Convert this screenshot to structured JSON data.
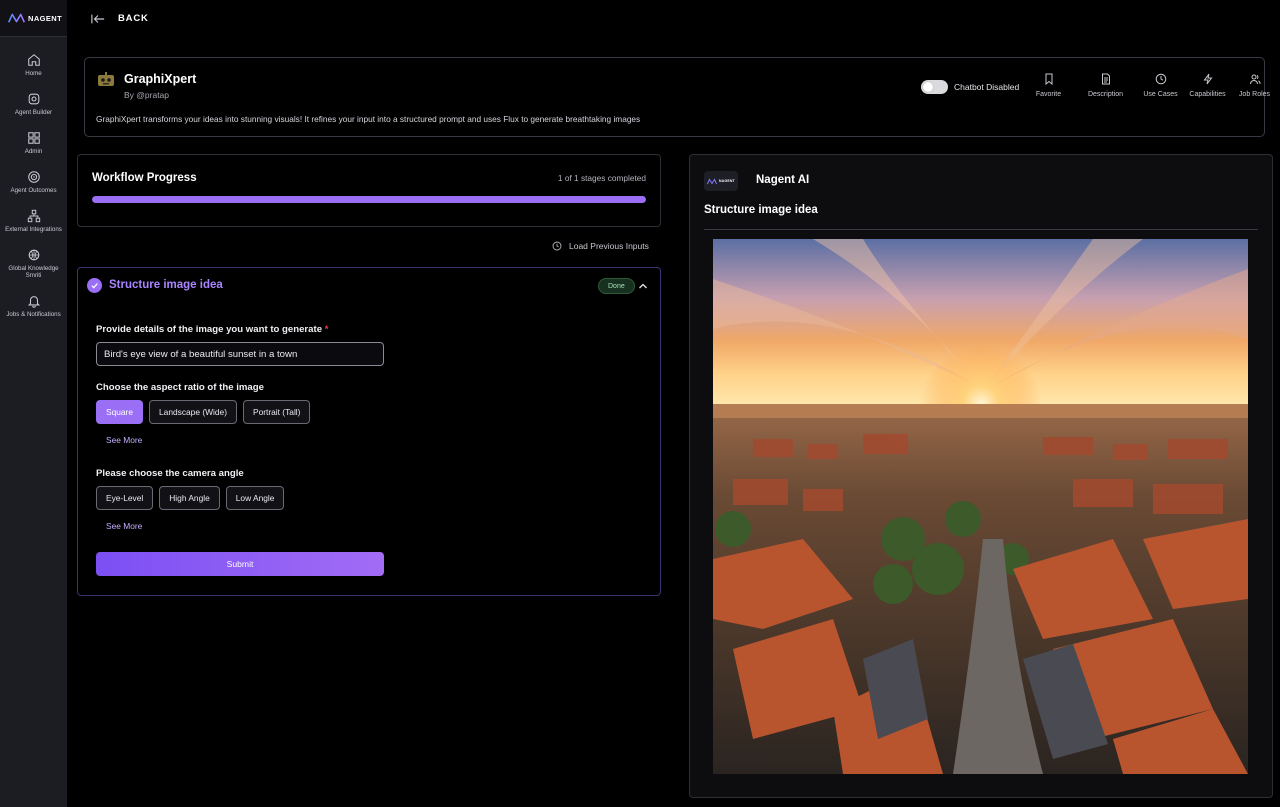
{
  "brand": {
    "name": "NAGENT"
  },
  "sidebar": {
    "items": [
      {
        "label": "Home",
        "icon": "home-icon"
      },
      {
        "label": "Agent Builder",
        "icon": "gear-icon"
      },
      {
        "label": "Admin",
        "icon": "grid-icon"
      },
      {
        "label": "Agent Outcomes",
        "icon": "target-icon"
      },
      {
        "label": "External Integrations",
        "icon": "network-icon"
      },
      {
        "label": "Global Knowledge Smriti",
        "icon": "knowledge-icon"
      },
      {
        "label": "Jobs & Notifications",
        "icon": "bell-icon"
      }
    ]
  },
  "topbar": {
    "back_label": "BACK"
  },
  "agent": {
    "name": "GraphiXpert",
    "by": "By @pratap",
    "description": "GraphiXpert transforms your ideas into stunning visuals! It refines your input into a structured prompt and uses Flux to generate breathtaking images",
    "chatbot_status": "Chatbot Disabled",
    "chatbot_enabled": false,
    "actions": [
      {
        "label": "Favorite",
        "icon": "bookmark-icon"
      },
      {
        "label": "Description",
        "icon": "document-icon"
      },
      {
        "label": "Use Cases",
        "icon": "clock-icon"
      },
      {
        "label": "Capabilities",
        "icon": "lightning-icon"
      },
      {
        "label": "Job Roles",
        "icon": "users-icon"
      }
    ]
  },
  "workflow": {
    "title": "Workflow Progress",
    "count_text": "1 of 1 stages completed",
    "progress": 1.0
  },
  "load_previous": {
    "label": "Load Previous Inputs"
  },
  "stage": {
    "title": "Structure image idea",
    "status": "Done",
    "q1": {
      "label": "Provide details of the image you want to generate",
      "required_mark": "*",
      "value": "Bird's eye view of a beautiful sunset in a town"
    },
    "q2": {
      "label": "Choose the aspect ratio of the image",
      "options": [
        "Square",
        "Landscape (Wide)",
        "Portrait (Tall)"
      ],
      "selected": "Square",
      "see_more": "See More"
    },
    "q3": {
      "label": "Please choose the camera angle",
      "options": [
        "Eye-Level",
        "High Angle",
        "Low Angle"
      ],
      "selected": null,
      "see_more": "See More"
    },
    "submit_label": "Submit"
  },
  "preview": {
    "logo_text": "NAGENT",
    "name": "Nagent AI",
    "title": "Structure image idea",
    "image_alt": "aerial sunset over town"
  },
  "colors": {
    "accent": "#9b6ff5",
    "accent_text": "#a985ff",
    "background": "#000000",
    "sidebar": "#1c1c23"
  }
}
